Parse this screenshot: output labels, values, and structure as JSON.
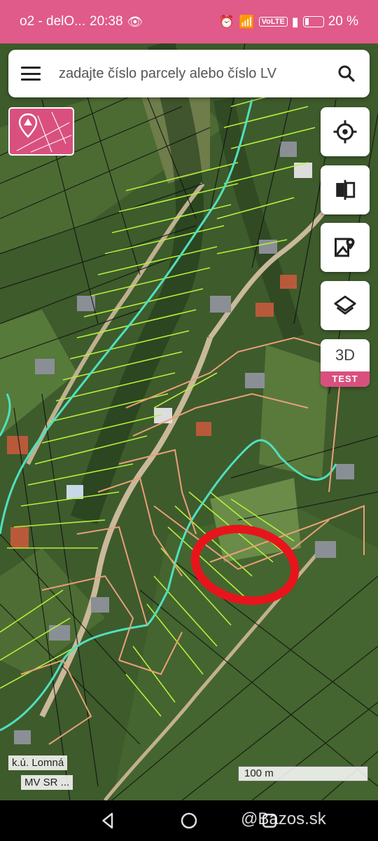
{
  "status_bar": {
    "carrier": "o2 - delO...",
    "time": "20:38",
    "volte": "VoLTE",
    "battery": "20 %"
  },
  "search": {
    "placeholder": "zadajte číslo parcely alebo číslo LV"
  },
  "side_buttons": {
    "three_d_label": "3D",
    "three_d_badge": "TEST"
  },
  "map": {
    "cadastral_area_label": "k.ú. Lomná",
    "source_label": "MV SR ...",
    "scale_label": "100 m"
  },
  "watermark": "@Bazos.sk",
  "colors": {
    "status_bar": "#e05a8a",
    "accent": "#d9507f",
    "parcel_green": "#b6f03c",
    "boundary_teal": "#4fe0c0",
    "parcel_orange": "#e8a078",
    "annotation_red": "#e8141c"
  },
  "icons": {
    "location": "crosshair-icon",
    "compare": "split-compare-icon",
    "google_maps": "google-maps-icon",
    "layers": "layers-icon",
    "menu": "menu-icon",
    "search": "search-icon"
  }
}
